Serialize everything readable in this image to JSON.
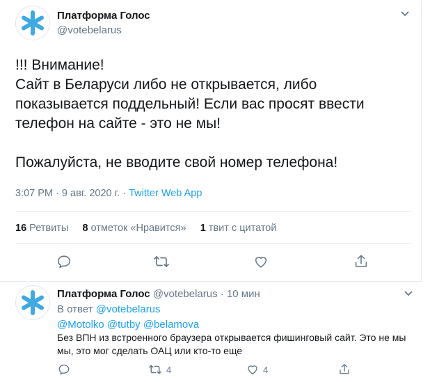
{
  "main_tweet": {
    "display_name": "Платформа Голос",
    "handle": "@votebelarus",
    "body_lines": [
      "!!! Внимание!",
      "Сайт в Беларуси либо не открывается, либо",
      "показывается поддельный! Если вас просят ввести",
      "телефон на сайте - это не мы!",
      "Пожалуйста, не вводите свой номер телефона!"
    ],
    "time": "3:07 PM",
    "separator": "·",
    "date": "9 авг. 2020 г.",
    "app": "Twitter Web App",
    "stats": {
      "retweets_count": "16",
      "retweets_label": "Ретвиты",
      "likes_count": "8",
      "likes_label": "отметок «Нравится»",
      "quotes_count": "1",
      "quotes_label": "твит с цитатой"
    }
  },
  "reply_tweet": {
    "display_name": "Платформа Голос",
    "handle": "@votebelarus",
    "separator": "·",
    "time_ago": "10 мин",
    "reply_prefix": "В ответ",
    "reply_to": "@votebelarus",
    "mentions": "@Motolko @tutby @belamova",
    "text": "Без ВПН из встроенного браузера открывается фишинговый сайт. Это не мы мы, это мог сделать ОАЦ или кто-то еще",
    "retweet_count": "4",
    "like_count": "4"
  },
  "colors": {
    "accent": "#1da1f2",
    "avatar_star": "#3fa9e0",
    "muted": "#657786",
    "text": "#14171a",
    "divider": "#e6ecf0"
  },
  "icons": [
    "star-logo-icon",
    "chevron-down-icon",
    "reply-icon",
    "retweet-icon",
    "like-icon",
    "share-icon"
  ]
}
